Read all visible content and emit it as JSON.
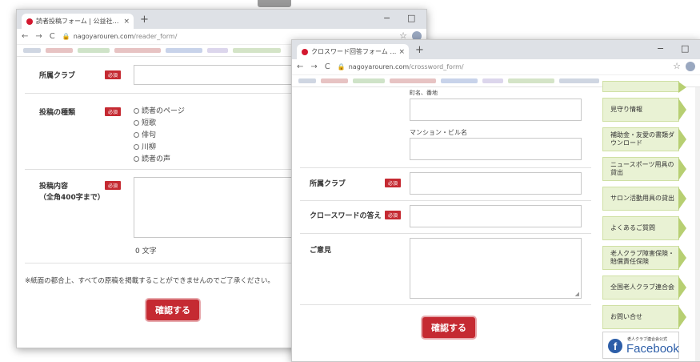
{
  "window1": {
    "tab_title": "読者投稿フォーム | 公益社団法人名",
    "tab_close": "×",
    "new_tab": "+",
    "minimize": "−",
    "maximize": "□",
    "url_host": "nagoyarouren.com",
    "url_path": "/reader_form/",
    "form": {
      "club_label": "所属クラブ",
      "required_badge": "必須",
      "type_label": "投稿の種類",
      "type_options": [
        "読者のページ",
        "短歌",
        "俳句",
        "川柳",
        "読者の声"
      ],
      "content_label": "投稿内容",
      "content_sub": "（全角400字まで）",
      "char_count": "0 文字",
      "notice": "※紙面の都合上、すべての原稿を掲載することができませんのでご了承ください。",
      "confirm_button": "確認する"
    }
  },
  "window2": {
    "tab_title": "クロスワード回答フォーム | 公益社団法",
    "tab_close": "×",
    "new_tab": "+",
    "minimize": "−",
    "maximize": "□",
    "url_host": "nagoyarouren.com",
    "url_path": "/crossword_form/",
    "form": {
      "address_label": "町名、番地",
      "mansion_label": "マンション・ビル名",
      "club_label": "所属クラブ",
      "required_badge": "必須",
      "answer_label": "クロースワードの答え",
      "opinion_label": "ご意見",
      "confirm_button": "確認する"
    },
    "sidebar": [
      "見守り情報",
      "補助金・友愛の書類ダウンロード",
      "ニュースポーツ用具の貸出",
      "サロン活動用具の貸出",
      "よくあるご質問",
      "老人クラブ障害保険・賠償責任保険",
      "全国老人クラブ連合会",
      "お問い合せ"
    ],
    "facebook_caption": "老人クラブ連合会公式",
    "facebook_word": "Facebook"
  },
  "colors": {
    "accent_red": "#c52a32",
    "sidebar_green": "#e9f2d4",
    "facebook_blue": "#2d5ea8"
  }
}
